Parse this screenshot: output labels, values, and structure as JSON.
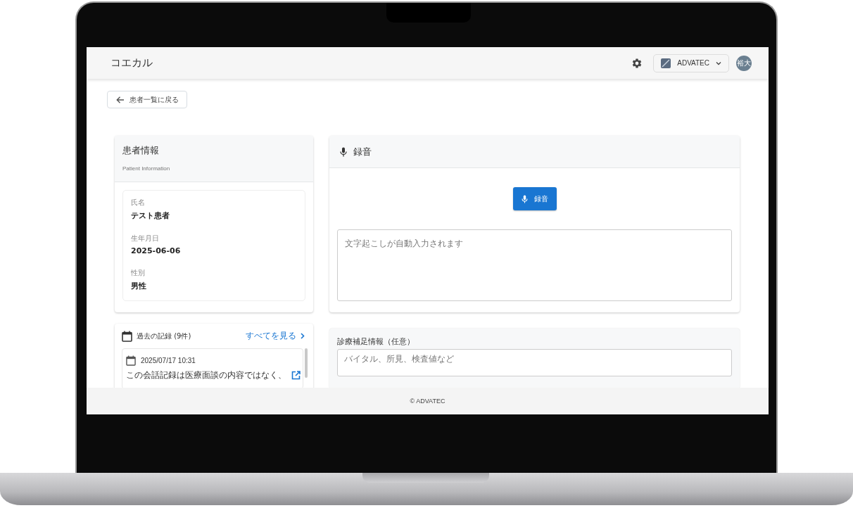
{
  "app": {
    "title": "コエカル"
  },
  "header": {
    "org_selector": {
      "label": "ADVATEC"
    },
    "avatar": {
      "initials": "裕大"
    }
  },
  "back_button": {
    "label": "患者一覧に戻る"
  },
  "patient_card": {
    "title": "患者情報",
    "subtitle": "Patient Information",
    "fields": [
      {
        "label": "氏名",
        "value": "テスト患者"
      },
      {
        "label": "生年月日",
        "value": "2025-06-06"
      },
      {
        "label": "性別",
        "value": "男性"
      }
    ]
  },
  "records": {
    "title": "過去の記録 (9件)",
    "link": "すべてを見る",
    "items": [
      {
        "datetime": "2025/07/17 10:31",
        "summary": "この会話記録は医療面談の内容ではなく、"
      }
    ]
  },
  "recording": {
    "title": "録音",
    "button": "録音",
    "transcript": {
      "placeholder": "文字起こしが自動入力されます"
    }
  },
  "supplement": {
    "label": "診療補足情報（任意）",
    "placeholder": "バイタル、所見、検査値など"
  },
  "footer": {
    "text": "© ADVATEC"
  }
}
